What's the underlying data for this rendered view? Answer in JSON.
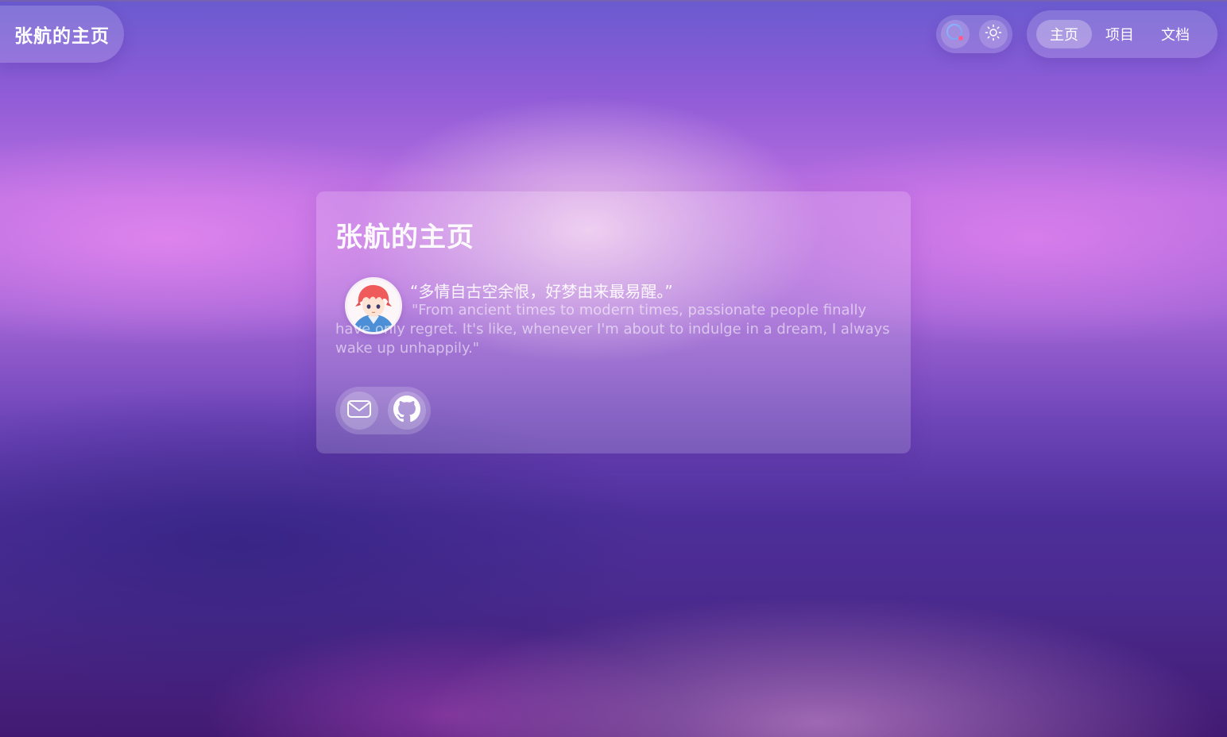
{
  "header": {
    "brand": "张航的主页",
    "tools": [
      {
        "icon": "search-icon"
      },
      {
        "icon": "sun-icon"
      }
    ],
    "nav": [
      {
        "label": "主页",
        "active": true
      },
      {
        "label": "项目",
        "active": false
      },
      {
        "label": "文档",
        "active": false
      }
    ]
  },
  "card": {
    "title": "张航的主页",
    "quote_zh": "“多情自古空余恨，好梦由来最易醒。”",
    "quote_en": "\"From ancient times to modern times, passionate people finally have only regret. It's like, whenever I'm about to indulge in a dream, I always wake up unhappily.\"",
    "social": [
      {
        "icon": "mail-icon"
      },
      {
        "icon": "github-icon"
      }
    ]
  },
  "colors": {
    "accent_purple": "#8d5bd6",
    "card_overlay": "rgba(255,255,255,0.16)",
    "text": "#ffffff"
  }
}
